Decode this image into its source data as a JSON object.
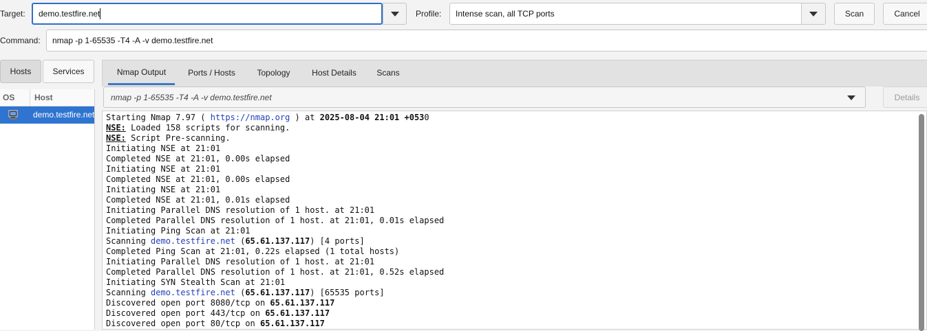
{
  "target": {
    "label": "Target:",
    "value": "demo.testfire.net"
  },
  "profile": {
    "label": "Profile:",
    "value": "Intense scan, all TCP ports"
  },
  "buttons": {
    "scan": "Scan",
    "cancel": "Cancel",
    "details": "Details"
  },
  "command": {
    "label": "Command:",
    "value": "nmap -p 1-65535 -T4 -A -v demo.testfire.net"
  },
  "left_tabs": {
    "hosts": "Hosts",
    "services": "Services"
  },
  "host_table": {
    "col_os": "OS",
    "col_host": "Host",
    "rows": [
      {
        "host": "demo.testfire.net"
      }
    ]
  },
  "tabs": [
    "Nmap Output",
    "Ports / Hosts",
    "Topology",
    "Host Details",
    "Scans"
  ],
  "output_selector": "nmap -p 1-65535 -T4 -A -v demo.testfire.net",
  "output": {
    "l1_a": "Starting Nmap 7.97 ( ",
    "l1_link": "https://nmap.org",
    "l1_b": " ) at ",
    "l1_date": "2025-08-04 21:01 +053",
    "l1_c": "0",
    "l2_k": "NSE:",
    "l2_t": " Loaded 158 scripts for scanning.",
    "l3_k": "NSE:",
    "l3_t": " Script Pre-scanning.",
    "l4": "Initiating NSE at 21:01",
    "l5": "Completed NSE at 21:01, 0.00s elapsed",
    "l6": "Initiating NSE at 21:01",
    "l7": "Completed NSE at 21:01, 0.00s elapsed",
    "l8": "Initiating NSE at 21:01",
    "l9": "Completed NSE at 21:01, 0.01s elapsed",
    "l10": "Initiating Parallel DNS resolution of 1 host. at 21:01",
    "l11": "Completed Parallel DNS resolution of 1 host. at 21:01, 0.01s elapsed",
    "l12": "Initiating Ping Scan at 21:01",
    "l13_a": "Scanning ",
    "l13_link": "demo.testfire.net",
    "l13_b": " (",
    "l13_ip": "65.61.137.117",
    "l13_c": ") [4 ports]",
    "l14": "Completed Ping Scan at 21:01, 0.22s elapsed (1 total hosts)",
    "l15": "Initiating Parallel DNS resolution of 1 host. at 21:01",
    "l16": "Completed Parallel DNS resolution of 1 host. at 21:01, 0.52s elapsed",
    "l17": "Initiating SYN Stealth Scan at 21:01",
    "l18_a": "Scanning ",
    "l18_link": "demo.testfire.net",
    "l18_b": " (",
    "l18_ip": "65.61.137.117",
    "l18_c": ") [65535 ports]",
    "l19_a": "Discovered open port 8080/tcp on ",
    "l19_ip": "65.61.137.117",
    "l20_a": "Discovered open port 443/tcp on ",
    "l20_ip": "65.61.137.117",
    "l21_a": "Discovered open port 80/tcp on ",
    "l21_ip": "65.61.137.117"
  }
}
